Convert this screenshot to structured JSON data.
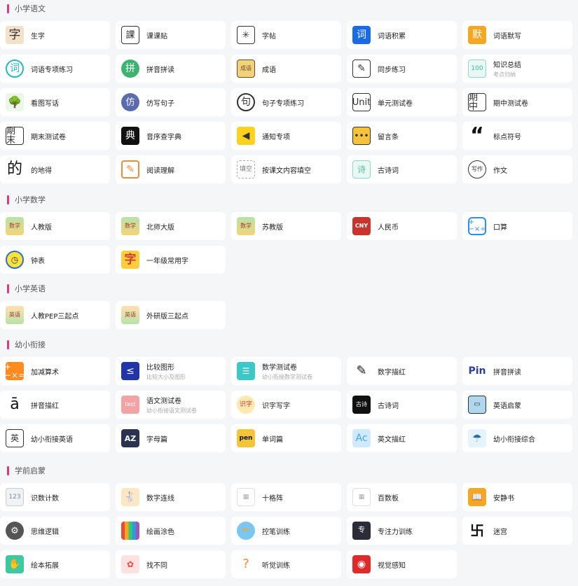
{
  "sections": [
    {
      "title": "小学语文",
      "items": [
        {
          "label": "生字",
          "icon": "zi-icon",
          "glyph": "字"
        },
        {
          "label": "课课贴",
          "icon": "lesson-icon",
          "glyph": "課"
        },
        {
          "label": "字帖",
          "icon": "grid-icon",
          "glyph": "✳"
        },
        {
          "label": "词语积累",
          "icon": "word-icon",
          "glyph": "词"
        },
        {
          "label": "词语默写",
          "icon": "dictation-icon",
          "glyph": "默"
        },
        {
          "label": "词语专项练习",
          "icon": "word-circle-icon",
          "glyph": "词"
        },
        {
          "label": "拼音拼读",
          "icon": "pinyin-icon",
          "glyph": "拼"
        },
        {
          "label": "成语",
          "icon": "idiom-book-icon",
          "glyph": "成语"
        },
        {
          "label": "同步练习",
          "icon": "exercise-doc-icon",
          "glyph": "✎"
        },
        {
          "label": "知识总结",
          "sub": "考点归纳",
          "icon": "summary-icon",
          "glyph": "100"
        },
        {
          "label": "看图写话",
          "icon": "tree-icon",
          "glyph": "🌳"
        },
        {
          "label": "仿写句子",
          "icon": "imitate-icon",
          "glyph": "仿"
        },
        {
          "label": "句子专项练习",
          "icon": "sentence-icon",
          "glyph": "句"
        },
        {
          "label": "单元测试卷",
          "icon": "unit-icon",
          "glyph": "Unit"
        },
        {
          "label": "期中测试卷",
          "icon": "midterm-icon",
          "glyph": "期中"
        },
        {
          "label": "期末测试卷",
          "icon": "final-icon",
          "glyph": "期末"
        },
        {
          "label": "音序查字典",
          "icon": "dictionary-icon",
          "glyph": "典"
        },
        {
          "label": "通知专项",
          "icon": "speaker-icon",
          "glyph": "◀"
        },
        {
          "label": "留言条",
          "icon": "message-icon",
          "glyph": "•••"
        },
        {
          "label": "标点符号",
          "icon": "quote-icon",
          "glyph": "“"
        },
        {
          "label": "的地得",
          "icon": "de-icon",
          "glyph": "的"
        },
        {
          "label": "阅读理解",
          "icon": "edit-icon",
          "glyph": "✎"
        },
        {
          "label": "按课文内容填空",
          "icon": "fill-blank-icon",
          "glyph": "填空"
        },
        {
          "label": "古诗词",
          "icon": "poem-icon",
          "glyph": "诗"
        },
        {
          "label": "作文",
          "icon": "writing-icon",
          "glyph": "写作"
        }
      ]
    },
    {
      "title": "小学数学",
      "items": [
        {
          "label": "人教版",
          "icon": "textbook-icon",
          "glyph": "数学"
        },
        {
          "label": "北师大版",
          "icon": "textbook-icon",
          "glyph": "数学"
        },
        {
          "label": "苏教版",
          "icon": "textbook-icon",
          "glyph": "数学"
        },
        {
          "label": "人民币",
          "icon": "cny-icon",
          "glyph": "CNY"
        },
        {
          "label": "口算",
          "icon": "calculator-icon",
          "glyph": "+−×÷"
        },
        {
          "label": "钟表",
          "icon": "clock-icon",
          "glyph": "◷"
        },
        {
          "label": "一年级常用字",
          "icon": "common-char-icon",
          "glyph": "字"
        }
      ]
    },
    {
      "title": "小学英语",
      "items": [
        {
          "label": "人教PEP三起点",
          "icon": "english-book-icon",
          "glyph": "英语"
        },
        {
          "label": "外研版三起点",
          "icon": "english-book-icon",
          "glyph": "英语"
        }
      ]
    },
    {
      "title": "幼小衔接",
      "items": [
        {
          "label": "加减算术",
          "icon": "arithmetic-icon",
          "glyph": "+−×="
        },
        {
          "label": "比较图形",
          "sub": "比较大小及图形",
          "icon": "compare-icon",
          "glyph": "≤"
        },
        {
          "label": "数学测试卷",
          "sub": "幼小衔接数学测试卷",
          "icon": "math-test-icon",
          "glyph": "☰"
        },
        {
          "label": "数字描红",
          "icon": "number-trace-icon",
          "glyph": "✎"
        },
        {
          "label": "拼音拼读",
          "icon": "pin-icon",
          "glyph": "Pin"
        },
        {
          "label": "拼音描红",
          "icon": "a-icon",
          "glyph": "ā"
        },
        {
          "label": "语文测试卷",
          "sub": "幼小衔接语文测试卷",
          "icon": "test-icon",
          "glyph": "test"
        },
        {
          "label": "识字写字",
          "icon": "literacy-icon",
          "glyph": "识字"
        },
        {
          "label": "古诗词",
          "icon": "ancient-poem-icon",
          "glyph": "古诗"
        },
        {
          "label": "英语启蒙",
          "icon": "tv-icon",
          "glyph": "▭"
        },
        {
          "label": "幼小衔接英语",
          "icon": "english-char-icon",
          "glyph": "英"
        },
        {
          "label": "字母篇",
          "icon": "az-icon",
          "glyph": "AZ"
        },
        {
          "label": "单词篇",
          "icon": "pen-word-icon",
          "glyph": "pen"
        },
        {
          "label": "英文描红",
          "icon": "ac-icon",
          "glyph": "Ac"
        },
        {
          "label": "幼小衔接综合",
          "icon": "umbrella-icon",
          "glyph": "☂"
        }
      ]
    },
    {
      "title": "学前启蒙",
      "items": [
        {
          "label": "识数计数",
          "icon": "counting-icon",
          "glyph": "123"
        },
        {
          "label": "数字连线",
          "icon": "rabbit-icon",
          "glyph": "🐇"
        },
        {
          "label": "十格阵",
          "icon": "ten-grid-icon",
          "glyph": "▦"
        },
        {
          "label": "百数板",
          "icon": "hundred-board-icon",
          "glyph": "▦"
        },
        {
          "label": "安静书",
          "icon": "quiet-book-icon",
          "glyph": "📖"
        },
        {
          "label": "思维逻辑",
          "icon": "logic-icon",
          "glyph": "⚙"
        },
        {
          "label": "绘画涂色",
          "icon": "crayon-icon",
          "glyph": ""
        },
        {
          "label": "控笔训练",
          "icon": "pencil-icon",
          "glyph": "✏"
        },
        {
          "label": "专注力训练",
          "icon": "focus-icon",
          "glyph": "专"
        },
        {
          "label": "迷宫",
          "icon": "maze-icon",
          "glyph": "卐"
        },
        {
          "label": "绘本拓展",
          "icon": "picture-book-icon",
          "glyph": "✋"
        },
        {
          "label": "找不同",
          "icon": "spot-difference-icon",
          "glyph": "✿"
        },
        {
          "label": "听觉训练",
          "icon": "ear-icon",
          "glyph": "?"
        },
        {
          "label": "视觉感知",
          "icon": "eye-icon",
          "glyph": "◉"
        }
      ]
    }
  ]
}
